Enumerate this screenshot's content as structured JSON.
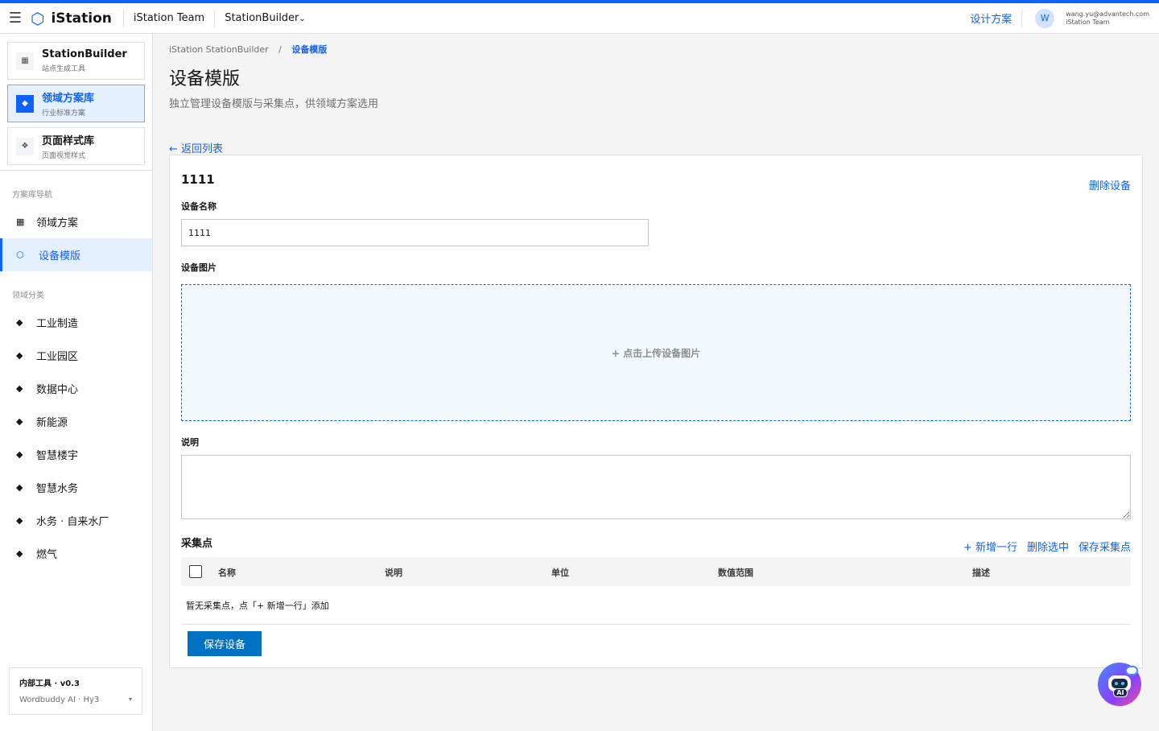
{
  "topbar": {
    "brand": "iStation",
    "team": "iStation Team",
    "product": "StationBuilder",
    "design_link": "设计方案",
    "avatar_initial": "W",
    "user_email": "wang.yu@advantech.com",
    "user_team": "iStation Team"
  },
  "sidebar": {
    "tools": [
      {
        "title": "StationBuilder",
        "sub": "站点生成工具"
      },
      {
        "title": "领域方案库",
        "sub": "行业标准方案"
      },
      {
        "title": "页面样式库",
        "sub": "页面视觉样式"
      }
    ],
    "section_nav": "方案库导航",
    "nav": [
      {
        "label": "领域方案"
      },
      {
        "label": "设备模版"
      }
    ],
    "section_domain": "领域分类",
    "domains": [
      {
        "label": "工业制造"
      },
      {
        "label": "工业园区"
      },
      {
        "label": "数据中心"
      },
      {
        "label": "新能源"
      },
      {
        "label": "智慧楼宇"
      },
      {
        "label": "智慧水务"
      },
      {
        "label": "水务 · 自来水厂"
      },
      {
        "label": "燃气"
      }
    ],
    "footer_title": "内部工具 · v0.3",
    "footer_model": "Wordbuddy AI · Hy3"
  },
  "main": {
    "breadcrumb_root": "iStation StationBuilder",
    "breadcrumb_sep": "/",
    "breadcrumb_current": "设备模版",
    "title": "设备模版",
    "subtitle": "独立管理设备模版与采集点，供领域方案选用",
    "back_link": "← 返回列表"
  },
  "device": {
    "title": "1111",
    "delete_label": "删除设备",
    "name_label": "设备名称",
    "name_value": "1111",
    "image_label": "设备图片",
    "upload_label": "+ 点击上传设备图片",
    "desc_label": "说明",
    "desc_value": ""
  },
  "points": {
    "title": "采集点",
    "add_label": "+ 新增一行",
    "delete_label": "删除选中",
    "save_label": "保存采集点",
    "columns": [
      "名称",
      "说明",
      "单位",
      "数值范围",
      "描述"
    ],
    "empty_text": "暂无采集点，点「+ 新增一行」添加"
  },
  "save_button": "保存设备",
  "ai_badge": "AI",
  "colors": {
    "primary": "#0f62fe",
    "save_button": "#0072c3",
    "active_bg": "#e5f0ff"
  }
}
